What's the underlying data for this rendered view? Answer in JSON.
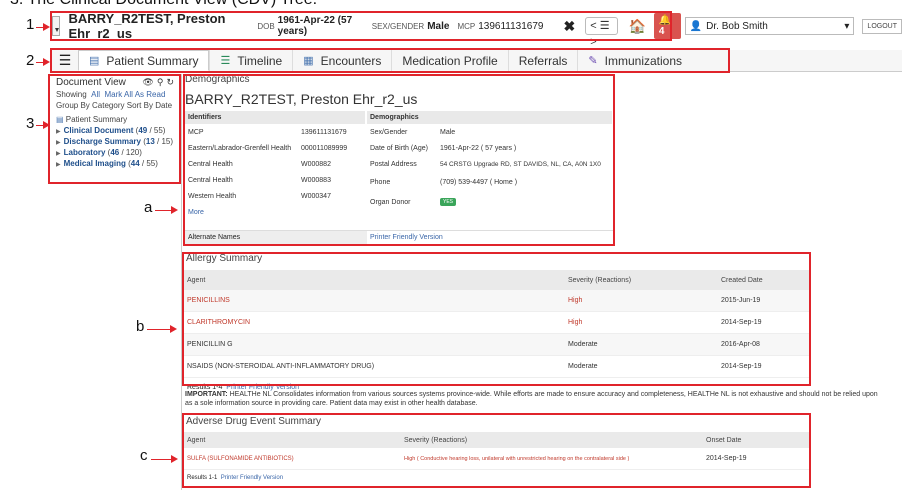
{
  "caption": "3.   The Clinical Document View (CDV) Tree.",
  "callouts": {
    "one": "1",
    "two": "2",
    "three": "3",
    "a": "a",
    "b": "b",
    "c": "c"
  },
  "header": {
    "patient_name": "BARRY_R2TEST, Preston Ehr_r2_us",
    "dob_label": "DOB",
    "dob_value": "1961-Apr-22 (57 years)",
    "sex_label": "SEX/GENDER",
    "sex_value": "Male",
    "mcp_label": "MCP",
    "mcp_value": "139611131679",
    "close_glyph": "✖",
    "nav_glyph": "< ☰ >",
    "home_glyph": "🏠",
    "alert_count": "4",
    "user_name": "Dr. Bob Smith",
    "logout_label": "LOGOUT"
  },
  "tabs": [
    {
      "label": "Patient Summary",
      "icon": "document-icon"
    },
    {
      "label": "Timeline",
      "icon": "timeline-icon"
    },
    {
      "label": "Encounters",
      "icon": "grid-icon"
    },
    {
      "label": "Medication Profile",
      "icon": ""
    },
    {
      "label": "Referrals",
      "icon": ""
    },
    {
      "label": "Immunizations",
      "icon": "syringe-icon"
    }
  ],
  "document_view": {
    "title": "Document View",
    "showing_label": "Showing",
    "showing_all": "All",
    "mark_all_read": "Mark All As Read",
    "group_by_label": "Group By",
    "group_by_value": "Category",
    "sort_by_label": "Sort By",
    "sort_by_value": "Date",
    "tree": [
      {
        "label": "Patient Summary",
        "bold": false
      },
      {
        "label": "Clinical Document",
        "count": "49",
        "total": "55"
      },
      {
        "label": "Discharge Summary",
        "count": "13",
        "total": "15"
      },
      {
        "label": "Laboratory",
        "count": "46",
        "total": "120"
      },
      {
        "label": "Medical Imaging",
        "count": "44",
        "total": "55"
      }
    ]
  },
  "demographics": {
    "section_title": "Demographics",
    "patient_name": "BARRY_R2TEST, Preston Ehr_r2_us",
    "identifiers_header": "Identifiers",
    "demographics_header": "Demographics",
    "identifiers": [
      {
        "label": "MCP",
        "value": "139611131679"
      },
      {
        "label": "Eastern/Labrador-Grenfell Health",
        "value": "000011089999"
      },
      {
        "label": "Central Health",
        "value": "W000882"
      },
      {
        "label": "Central Health",
        "value": "W000883"
      },
      {
        "label": "Western Health",
        "value": "W000347"
      }
    ],
    "more_link": "More",
    "fields": [
      {
        "label": "Sex/Gender",
        "value": "Male"
      },
      {
        "label": "Date of Birth (Age)",
        "value": "1961-Apr-22 ( 57 years )"
      },
      {
        "label": "Postal Address",
        "value": "54 CRSTG Upgrade RD, ST DAVIDS, NL, CA, A0N 1X0"
      },
      {
        "label": "Phone",
        "value": "(709) 539-4497  ( Home )"
      },
      {
        "label": "Organ Donor",
        "value": "YES"
      }
    ],
    "alternate_names": "Alternate Names",
    "printer_friendly": "Printer Friendly Version"
  },
  "allergy": {
    "title": "Allergy Summary",
    "headers": [
      "Agent",
      "Severity (Reactions)",
      "Created Date"
    ],
    "rows": [
      {
        "agent": "PENICILLINS",
        "severity": "High",
        "date": "2015-Jun-19",
        "high": true
      },
      {
        "agent": "CLARITHROMYCIN",
        "severity": "High",
        "date": "2014-Sep-19",
        "high": true
      },
      {
        "agent": "PENICILLIN G",
        "severity": "Moderate",
        "date": "2016-Apr-08",
        "high": false
      },
      {
        "agent": "NSAIDS (NON-STEROIDAL ANTI-INFLAMMATORY DRUG)",
        "severity": "Moderate",
        "date": "2014-Sep-19",
        "high": false
      }
    ],
    "results": "Results 1-4",
    "printer_friendly": "Printer Friendly Version"
  },
  "important": {
    "label": "IMPORTANT:",
    "text": "HEALTHe NL Consolidates information from various sources systems province-wide. While efforts are made to ensure accuracy and completeness, HEALTHe NL is not exhaustive and should not be relied upon as a sole information source in providing care. Patient data may exist in other health database."
  },
  "adverse": {
    "title": "Adverse Drug Event Summary",
    "headers": [
      "Agent",
      "Severity (Reactions)",
      "Onset Date"
    ],
    "rows": [
      {
        "agent": "SULFA (SULFONAMIDE ANTIBIOTICS)",
        "severity": "High ( Conductive hearing loss, unilateral with unrestricted hearing on the contralateral side )",
        "date": "2014-Sep-19"
      }
    ],
    "results": "Results 1-1",
    "printer_friendly": "Printer Friendly Version"
  },
  "colors": {
    "annotation_red": "#e0242b",
    "link_blue": "#3a66a8",
    "severity_high": "#c0392b"
  }
}
